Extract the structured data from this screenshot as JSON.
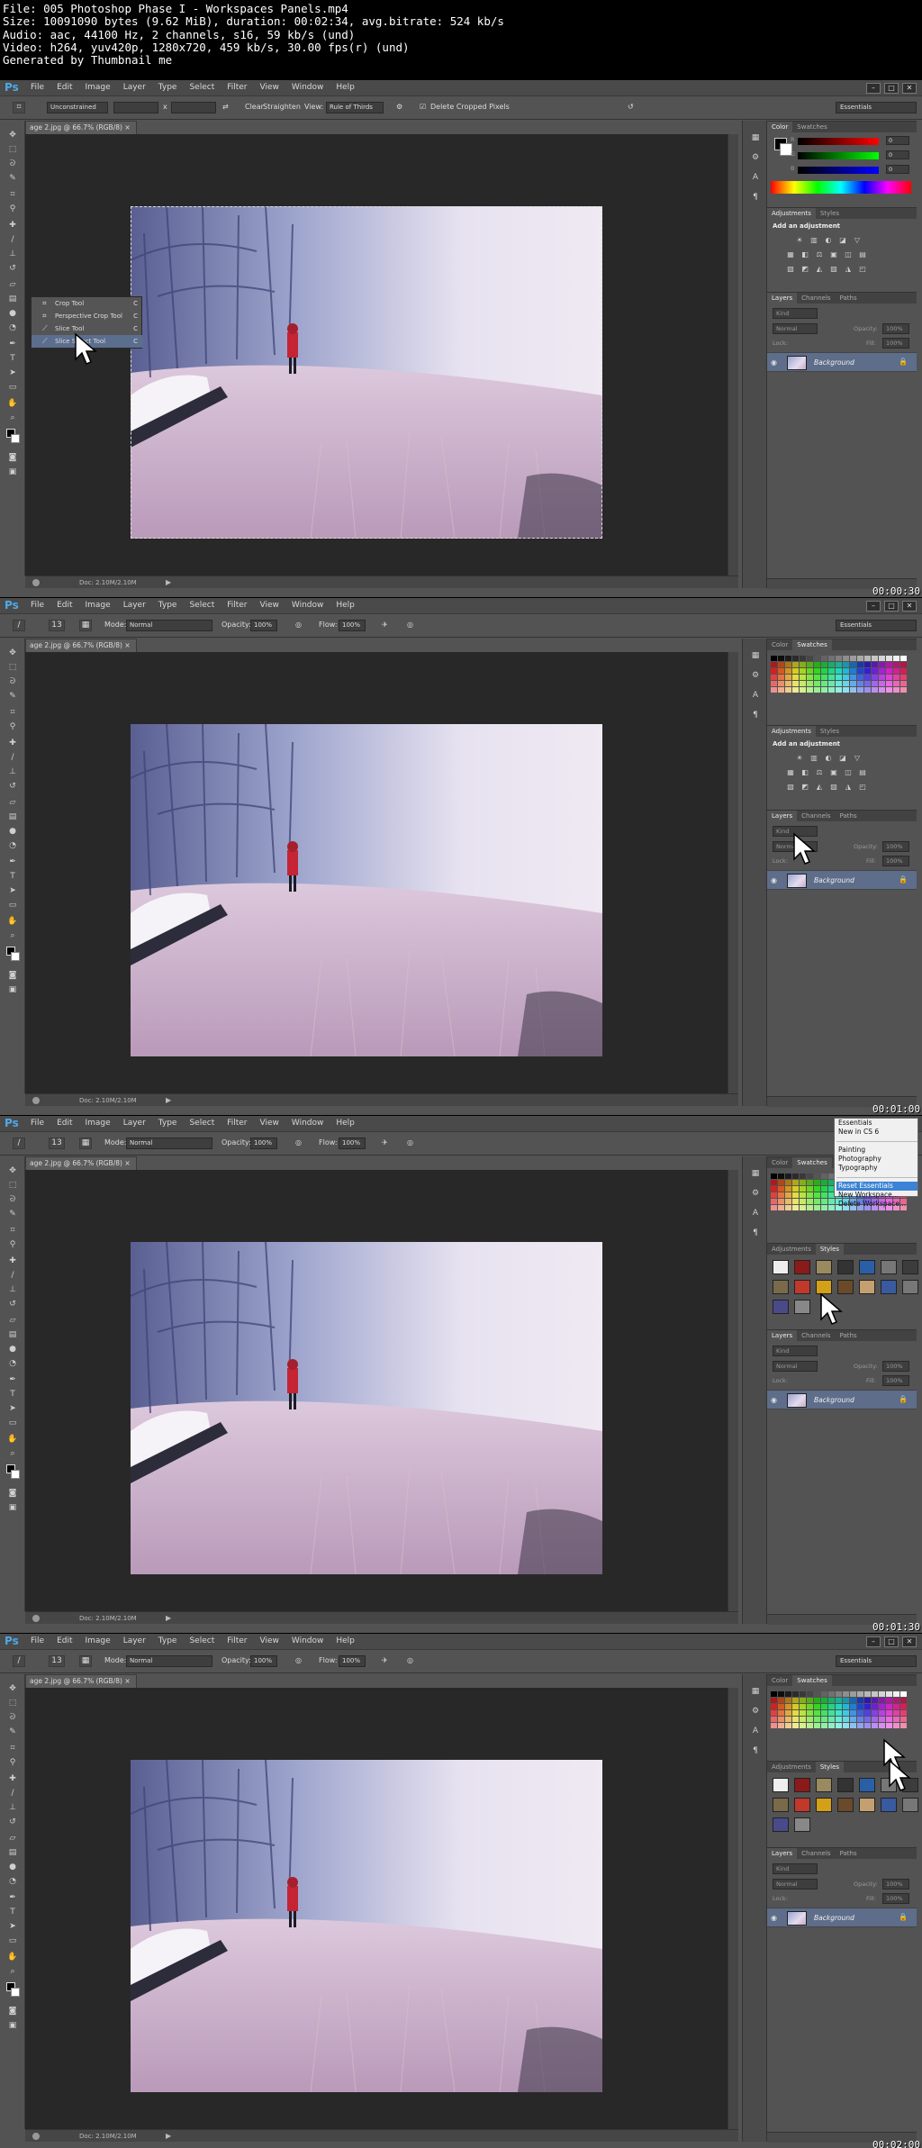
{
  "meta": {
    "lines": [
      "File: 005 Photoshop Phase I - Workspaces Panels.mp4",
      "Size: 10091090 bytes (9.62 MiB), duration: 00:02:34, avg.bitrate: 524 kb/s",
      "Audio: aac, 44100 Hz, 2 channels, s16, 59 kb/s (und)",
      "Video: h264, yuv420p, 1280x720, 459 kb/s, 30.00 fps(r) (und)",
      "Generated by Thumbnail me"
    ]
  },
  "app": {
    "logo": "Ps",
    "menu": [
      "File",
      "Edit",
      "Image",
      "Layer",
      "Type",
      "Select",
      "Filter",
      "View",
      "Window",
      "Help"
    ],
    "window_buttons": [
      "–",
      "□",
      "✕"
    ],
    "workspace": "Essentials",
    "doc_tab": "age 2.jpg @ 66.7% (RGB/8)",
    "status_doc": "Doc: 2.10M/2.10M"
  },
  "crop_options": {
    "ratio": "Unconstrained",
    "x": "x",
    "clear": "Clear",
    "straighten": "Straighten",
    "view_label": "View:",
    "view_value": "Rule of Thirds",
    "delete_cropped": "Delete Cropped Pixels"
  },
  "brush_options": {
    "size": "13",
    "mode_label": "Mode:",
    "mode_value": "Normal",
    "opacity_label": "Opacity:",
    "opacity_value": "100%",
    "flow_label": "Flow:",
    "flow_value": "100%"
  },
  "panels": {
    "color_tabs": [
      "Color",
      "Swatches"
    ],
    "color_channels": [
      "R",
      "G",
      "B"
    ],
    "color_values": [
      "0",
      "0",
      "0"
    ],
    "adjust_tabs": [
      "Adjustments",
      "Styles"
    ],
    "adjust_title": "Add an adjustment",
    "layers_tabs": [
      "Layers",
      "Channels",
      "Paths"
    ],
    "layers_kind": "Kind",
    "layers_blend": "Normal",
    "opacity_label": "Opacity:",
    "opacity_value": "100%",
    "lock_label": "Lock:",
    "fill_label": "Fill:",
    "fill_value": "100%",
    "layer_name": "Background"
  },
  "crop_flyout": {
    "items": [
      {
        "label": "Crop Tool",
        "key": "C"
      },
      {
        "label": "Perspective Crop Tool",
        "key": "C"
      },
      {
        "label": "Slice Tool",
        "key": "C"
      },
      {
        "label": "Slice Select Tool",
        "key": "C"
      }
    ]
  },
  "workspace_menu": {
    "items": [
      "Essentials",
      "New in CS 6",
      "Painting",
      "Photography",
      "Typography",
      "Reset Essentials",
      "New Workspace...",
      "Delete Workspace..."
    ]
  },
  "timestamps": [
    "00:00:30",
    "00:01:00",
    "00:01:30",
    "00:02:00"
  ],
  "colors": {
    "accent": "#4fa9e6",
    "layer_selected": "#5d6d8a",
    "menu_highlight": "#3a83d6"
  }
}
